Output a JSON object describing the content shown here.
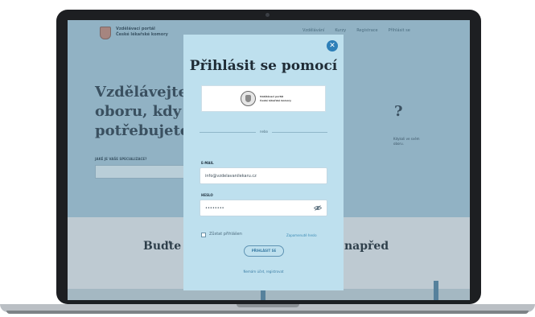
{
  "site": {
    "brand": {
      "line1": "Vzdělávací portál",
      "line2": "České lékařské komory"
    },
    "nav": [
      "Vzdělávání",
      "Kurzy",
      "Registrace",
      "Přihlásit se"
    ],
    "hero": {
      "title_line1": "Vzdělávejte",
      "title_line2": "oboru, kdy",
      "title_line3": "potřebujete",
      "question": "JAKÉ JE VAŠE SPECIALIZACE?",
      "side_mark": "?",
      "side_text": "Kdykoli ve svém oboru."
    },
    "lower": {
      "left": "Buďte v",
      "right": "napřed"
    }
  },
  "modal": {
    "title": "Přihlásit se pomocí",
    "close_icon": "close-icon",
    "provider": {
      "line1": "Vzdělávací portál",
      "line2": "České lékařské komory"
    },
    "divider_label": "nebo",
    "email": {
      "label": "E-MAIL",
      "value": "info@vzdelavanilekaru.cz"
    },
    "password": {
      "label": "HESLO",
      "value": "••••••••",
      "toggle_icon": "eye-slash-icon"
    },
    "remember_label": "Zůstat přihlášen",
    "forgot_link": "Zapomenuté heslo",
    "login_button": "PŘIHLÁSIT SE",
    "register_link": "Nemám účet, registrovat"
  },
  "colors": {
    "modal_bg": "#bee0ee",
    "accent": "#2d7fb8",
    "site_bg": "#97b6c7"
  }
}
